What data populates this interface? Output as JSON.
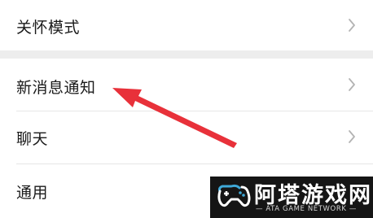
{
  "settings": {
    "items": [
      {
        "label": "关怀模式",
        "icon": "chevron-right-icon"
      },
      {
        "label": "新消息通知",
        "icon": "chevron-right-icon"
      },
      {
        "label": "聊天",
        "icon": "chevron-right-icon"
      },
      {
        "label": "通用",
        "icon": "chevron-right-icon"
      }
    ]
  },
  "annotation": {
    "arrow_color": "#e8313a",
    "target": "新消息通知"
  },
  "watermark": {
    "title": "阿塔游戏网",
    "subtitle": "ATA GAME NETWORK",
    "logo_icon": "gamepad-icon",
    "accent": "#3fa9d8"
  }
}
